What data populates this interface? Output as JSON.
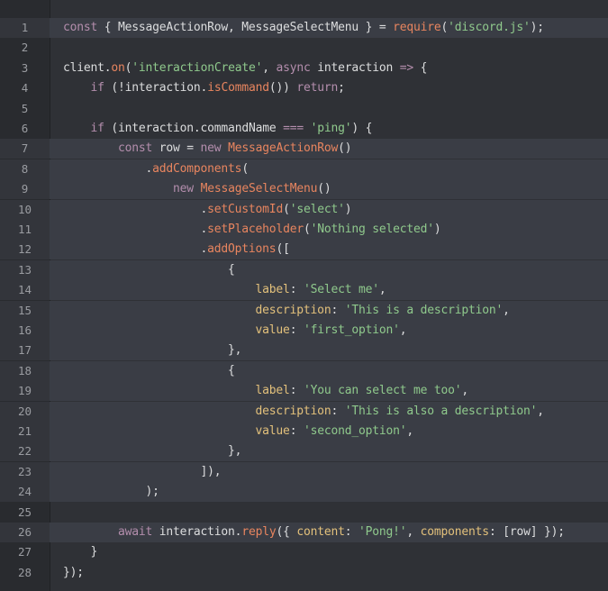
{
  "editor": {
    "lines": [
      {
        "n": "1",
        "hl": true,
        "tokens": [
          [
            "kw",
            "const"
          ],
          [
            "plain",
            " { MessageActionRow, MessageSelectMenu } = "
          ],
          [
            "fn",
            "require"
          ],
          [
            "plain",
            "("
          ],
          [
            "str",
            "'discord.js'"
          ],
          [
            "plain",
            ");"
          ]
        ]
      },
      {
        "n": "2",
        "hl": false,
        "tokens": []
      },
      {
        "n": "3",
        "hl": false,
        "tokens": [
          [
            "plain",
            "client."
          ],
          [
            "fn",
            "on"
          ],
          [
            "plain",
            "("
          ],
          [
            "str",
            "'interactionCreate'"
          ],
          [
            "plain",
            ", "
          ],
          [
            "kw",
            "async"
          ],
          [
            "plain",
            " interaction "
          ],
          [
            "kw",
            "=>"
          ],
          [
            "plain",
            " {"
          ]
        ]
      },
      {
        "n": "4",
        "hl": false,
        "tokens": [
          [
            "plain",
            "    "
          ],
          [
            "kw",
            "if"
          ],
          [
            "plain",
            " (!interaction."
          ],
          [
            "fn",
            "isCommand"
          ],
          [
            "plain",
            "()) "
          ],
          [
            "kw",
            "return"
          ],
          [
            "plain",
            ";"
          ]
        ]
      },
      {
        "n": "5",
        "hl": false,
        "tokens": []
      },
      {
        "n": "6",
        "hl": false,
        "tokens": [
          [
            "plain",
            "    "
          ],
          [
            "kw",
            "if"
          ],
          [
            "plain",
            " (interaction.commandName "
          ],
          [
            "kw",
            "==="
          ],
          [
            "plain",
            " "
          ],
          [
            "str",
            "'ping'"
          ],
          [
            "plain",
            ") {"
          ]
        ]
      },
      {
        "n": "7",
        "hl": true,
        "tokens": [
          [
            "plain",
            "        "
          ],
          [
            "kw",
            "const"
          ],
          [
            "plain",
            " row = "
          ],
          [
            "kw",
            "new"
          ],
          [
            "plain",
            " "
          ],
          [
            "cls",
            "MessageActionRow"
          ],
          [
            "plain",
            "()"
          ]
        ]
      },
      {
        "n": "8",
        "hl": true,
        "tokens": [
          [
            "plain",
            "            ."
          ],
          [
            "fn",
            "addComponents"
          ],
          [
            "plain",
            "("
          ]
        ]
      },
      {
        "n": "9",
        "hl": true,
        "tokens": [
          [
            "plain",
            "                "
          ],
          [
            "kw",
            "new"
          ],
          [
            "plain",
            " "
          ],
          [
            "cls",
            "MessageSelectMenu"
          ],
          [
            "plain",
            "()"
          ]
        ]
      },
      {
        "n": "10",
        "hl": true,
        "tokens": [
          [
            "plain",
            "                    ."
          ],
          [
            "fn",
            "setCustomId"
          ],
          [
            "plain",
            "("
          ],
          [
            "str",
            "'select'"
          ],
          [
            "plain",
            ")"
          ]
        ]
      },
      {
        "n": "11",
        "hl": true,
        "tokens": [
          [
            "plain",
            "                    ."
          ],
          [
            "fn",
            "setPlaceholder"
          ],
          [
            "plain",
            "("
          ],
          [
            "str",
            "'Nothing selected'"
          ],
          [
            "plain",
            ")"
          ]
        ]
      },
      {
        "n": "12",
        "hl": true,
        "tokens": [
          [
            "plain",
            "                    ."
          ],
          [
            "fn",
            "addOptions"
          ],
          [
            "plain",
            "(["
          ]
        ]
      },
      {
        "n": "13",
        "hl": true,
        "tokens": [
          [
            "plain",
            "                        {"
          ]
        ]
      },
      {
        "n": "14",
        "hl": true,
        "tokens": [
          [
            "plain",
            "                            "
          ],
          [
            "prop",
            "label"
          ],
          [
            "plain",
            ": "
          ],
          [
            "str",
            "'Select me'"
          ],
          [
            "plain",
            ","
          ]
        ]
      },
      {
        "n": "15",
        "hl": true,
        "tokens": [
          [
            "plain",
            "                            "
          ],
          [
            "prop",
            "description"
          ],
          [
            "plain",
            ": "
          ],
          [
            "str",
            "'This is a description'"
          ],
          [
            "plain",
            ","
          ]
        ]
      },
      {
        "n": "16",
        "hl": true,
        "tokens": [
          [
            "plain",
            "                            "
          ],
          [
            "prop",
            "value"
          ],
          [
            "plain",
            ": "
          ],
          [
            "str",
            "'first_option'"
          ],
          [
            "plain",
            ","
          ]
        ]
      },
      {
        "n": "17",
        "hl": true,
        "tokens": [
          [
            "plain",
            "                        },"
          ]
        ]
      },
      {
        "n": "18",
        "hl": true,
        "tokens": [
          [
            "plain",
            "                        {"
          ]
        ]
      },
      {
        "n": "19",
        "hl": true,
        "tokens": [
          [
            "plain",
            "                            "
          ],
          [
            "prop",
            "label"
          ],
          [
            "plain",
            ": "
          ],
          [
            "str",
            "'You can select me too'"
          ],
          [
            "plain",
            ","
          ]
        ]
      },
      {
        "n": "20",
        "hl": true,
        "tokens": [
          [
            "plain",
            "                            "
          ],
          [
            "prop",
            "description"
          ],
          [
            "plain",
            ": "
          ],
          [
            "str",
            "'This is also a description'"
          ],
          [
            "plain",
            ","
          ]
        ]
      },
      {
        "n": "21",
        "hl": true,
        "tokens": [
          [
            "plain",
            "                            "
          ],
          [
            "prop",
            "value"
          ],
          [
            "plain",
            ": "
          ],
          [
            "str",
            "'second_option'"
          ],
          [
            "plain",
            ","
          ]
        ]
      },
      {
        "n": "22",
        "hl": true,
        "tokens": [
          [
            "plain",
            "                        },"
          ]
        ]
      },
      {
        "n": "23",
        "hl": true,
        "tokens": [
          [
            "plain",
            "                    ]),"
          ]
        ]
      },
      {
        "n": "24",
        "hl": true,
        "tokens": [
          [
            "plain",
            "            );"
          ]
        ]
      },
      {
        "n": "25",
        "hl": false,
        "tokens": []
      },
      {
        "n": "26",
        "hl": true,
        "tokens": [
          [
            "plain",
            "        "
          ],
          [
            "kw",
            "await"
          ],
          [
            "plain",
            " interaction."
          ],
          [
            "fn",
            "reply"
          ],
          [
            "plain",
            "({ "
          ],
          [
            "prop",
            "content"
          ],
          [
            "plain",
            ": "
          ],
          [
            "str",
            "'Pong!'"
          ],
          [
            "plain",
            ", "
          ],
          [
            "prop",
            "components"
          ],
          [
            "plain",
            ": [row] });"
          ]
        ]
      },
      {
        "n": "27",
        "hl": false,
        "tokens": [
          [
            "plain",
            "    }"
          ]
        ]
      },
      {
        "n": "28",
        "hl": false,
        "tokens": [
          [
            "plain",
            "});"
          ]
        ]
      }
    ]
  },
  "colors": {
    "background": "#2f3136",
    "highlight": "#3a3d45",
    "keyword": "#b48ead",
    "string": "#8fc98c",
    "function": "#e8855f",
    "property": "#e2c07b",
    "plain": "#dcddde"
  }
}
